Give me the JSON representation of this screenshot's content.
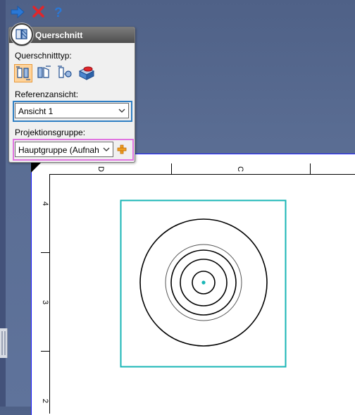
{
  "toolbar": {
    "ok_icon": "arrow-right-icon",
    "cancel_icon": "close-icon",
    "help_icon": "help-icon",
    "accent": "#2a78d6",
    "cancel_color": "#e0262b"
  },
  "panel": {
    "title": "Querschnitt",
    "type_label": "Querschnitttyp:",
    "types": [
      "full-section-icon",
      "half-section-icon",
      "offset-section-icon",
      "broken-out-section-icon"
    ],
    "ref_label": "Referenzansicht:",
    "ref_value": "Ansicht 1",
    "group_label": "Projektionsgruppe:",
    "group_value": "Hauptgruppe (Aufnah",
    "add_icon": "add-icon"
  },
  "sheet": {
    "zone_letters": [
      "D",
      "C"
    ],
    "zone_numbers": [
      "4",
      "3",
      "2"
    ],
    "view_border_color": "#19b6b6"
  }
}
